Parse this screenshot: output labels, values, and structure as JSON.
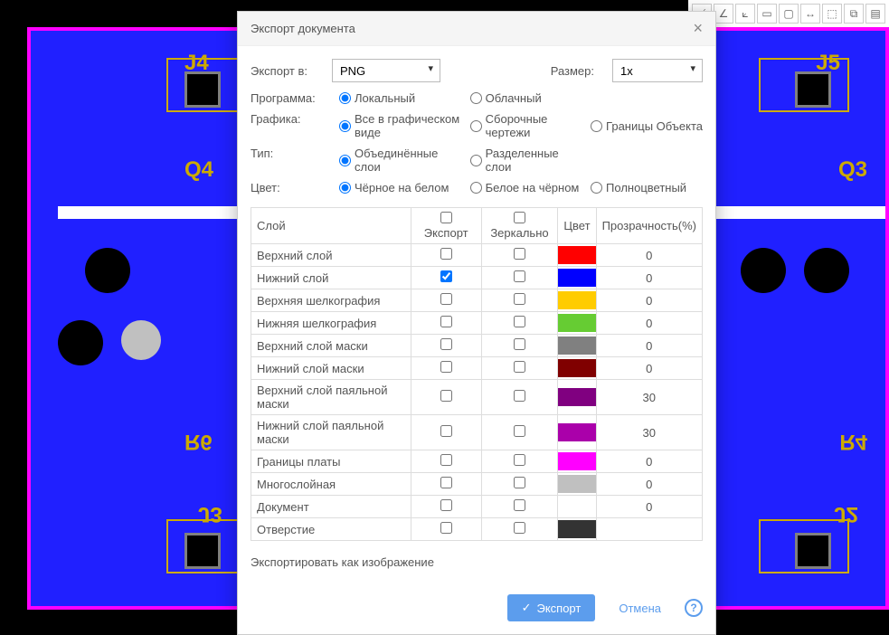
{
  "dialog": {
    "title": "Экспорт документа",
    "export_to_label": "Экспорт в:",
    "export_to_value": "PNG",
    "size_label": "Размер:",
    "size_value": "1x",
    "program_label": "Программа:",
    "program_opts": {
      "local": "Локальный",
      "cloud": "Облачный"
    },
    "graphics_label": "Графика:",
    "graphics_opts": {
      "all": "Все в графическом виде",
      "assembly": "Сборочные чертежи",
      "bounds": "Границы Объекта"
    },
    "type_label": "Тип:",
    "type_opts": {
      "merged": "Объединённые слои",
      "split": "Разделенные слои"
    },
    "color_label": "Цвет:",
    "color_opts": {
      "bw": "Чёрное на белом",
      "wb": "Белое на чёрном",
      "full": "Полноцветный"
    },
    "table": {
      "headers": {
        "layer": "Слой",
        "export": "Экспорт",
        "mirror": "Зеркально",
        "color": "Цвет",
        "transparency": "Прозрачность(%)"
      },
      "rows": [
        {
          "name": "Верхний слой",
          "export": false,
          "mirror": false,
          "color": "#ff0000",
          "trans": "0"
        },
        {
          "name": "Нижний слой",
          "export": true,
          "mirror": false,
          "color": "#0000ff",
          "trans": "0"
        },
        {
          "name": "Верхняя шелкография",
          "export": false,
          "mirror": false,
          "color": "#ffcc00",
          "trans": "0"
        },
        {
          "name": "Нижняя шелкография",
          "export": false,
          "mirror": false,
          "color": "#66cc33",
          "trans": "0"
        },
        {
          "name": "Верхний слой маски",
          "export": false,
          "mirror": false,
          "color": "#808080",
          "trans": "0"
        },
        {
          "name": "Нижний слой маски",
          "export": false,
          "mirror": false,
          "color": "#800000",
          "trans": "0"
        },
        {
          "name": "Верхний слой паяльной маски",
          "export": false,
          "mirror": false,
          "color": "#800080",
          "trans": "30"
        },
        {
          "name": "Нижний слой паяльной маски",
          "export": false,
          "mirror": false,
          "color": "#aa00aa",
          "trans": "30"
        },
        {
          "name": "Границы платы",
          "export": false,
          "mirror": false,
          "color": "#ff00ff",
          "trans": "0"
        },
        {
          "name": "Многослойная",
          "export": false,
          "mirror": false,
          "color": "#c0c0c0",
          "trans": "0"
        },
        {
          "name": "Документ",
          "export": false,
          "mirror": false,
          "color": "#ffffff",
          "trans": "0"
        },
        {
          "name": "Отверстие",
          "export": false,
          "mirror": false,
          "color": "#333333",
          "trans": ""
        }
      ]
    },
    "note": "Экспортировать как изображение",
    "export_btn": "Экспорт",
    "cancel_btn": "Отмена"
  },
  "pcb": {
    "labels": [
      "J4",
      "J5",
      "Q4",
      "Q3",
      "R6",
      "R4",
      "J3",
      "J2"
    ]
  }
}
